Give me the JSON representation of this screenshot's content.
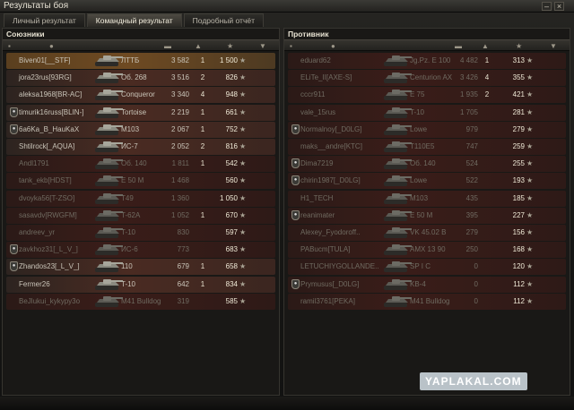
{
  "window": {
    "title": "Результаты боя",
    "minimize": "–",
    "close": "×"
  },
  "tabs": [
    {
      "label": "Личный результат",
      "active": false
    },
    {
      "label": "Командный результат",
      "active": true
    },
    {
      "label": "Подробный отчёт",
      "active": false
    }
  ],
  "allies": {
    "title": "Союзники",
    "rows": [
      {
        "name": "Biven01[__STF]",
        "tank": "ЛТТБ",
        "damage": "3 582",
        "frags": "1",
        "xp": "1 500",
        "state": "player"
      },
      {
        "name": "jora23rus[93RG]",
        "tank": "Об. 268",
        "damage": "3 516",
        "frags": "2",
        "xp": "826",
        "state": "alive"
      },
      {
        "name": "aleksa1968[BR-AC]",
        "tank": "Conqueror",
        "damage": "3 340",
        "frags": "4",
        "xp": "948",
        "state": "alive"
      },
      {
        "name": "timurik16russ[BLIN-]",
        "tank": "Tortoise",
        "damage": "2 219",
        "frags": "1",
        "xp": "661",
        "state": "alive",
        "badge": true
      },
      {
        "name": "6a6Ka_B_HauKaX",
        "tank": "M103",
        "damage": "2 067",
        "frags": "1",
        "xp": "752",
        "state": "alive",
        "badge": true
      },
      {
        "name": "Shtilrock[_AQUA]",
        "tank": "ИС-7",
        "damage": "2 052",
        "frags": "2",
        "xp": "816",
        "state": "alive"
      },
      {
        "name": "Andl1791",
        "tank": "Об. 140",
        "damage": "1 811",
        "frags": "1",
        "xp": "542",
        "state": "dead"
      },
      {
        "name": "tank_ekb[HDST]",
        "tank": "E 50 M",
        "damage": "1 468",
        "frags": "",
        "xp": "560",
        "state": "dead"
      },
      {
        "name": "dvoyka56[T-ZSO]",
        "tank": "T49",
        "damage": "1 360",
        "frags": "",
        "xp": "1 050",
        "state": "dead"
      },
      {
        "name": "sasavdv[RWGFM]",
        "tank": "T-62A",
        "damage": "1 052",
        "frags": "1",
        "xp": "670",
        "state": "dead"
      },
      {
        "name": "andreev_yr",
        "tank": "T-10",
        "damage": "830",
        "frags": "",
        "xp": "597",
        "state": "dead"
      },
      {
        "name": "zavkhoz31[_L_V_]",
        "tank": "ИС-6",
        "damage": "773",
        "frags": "",
        "xp": "683",
        "state": "dead",
        "badge": true
      },
      {
        "name": "Zhandos23[_L_V_]",
        "tank": "110",
        "damage": "679",
        "frags": "1",
        "xp": "658",
        "state": "alive",
        "badge": true
      },
      {
        "name": "Fermer26",
        "tank": "T-10",
        "damage": "642",
        "frags": "1",
        "xp": "834",
        "state": "alive"
      },
      {
        "name": "BeJlukui_kykypy3o",
        "tank": "M41 Bulldog",
        "damage": "319",
        "frags": "",
        "xp": "585",
        "state": "dead"
      }
    ]
  },
  "enemies": {
    "title": "Противник",
    "rows": [
      {
        "name": "eduard62",
        "tank": "Jg.Pz. E 100",
        "damage": "4 482",
        "frags": "1",
        "xp": "313",
        "state": "dead"
      },
      {
        "name": "ELiTe_II[AXE-S]",
        "tank": "Centurion AX",
        "damage": "3 426",
        "frags": "4",
        "xp": "355",
        "state": "dead"
      },
      {
        "name": "cccr911",
        "tank": "E 75",
        "damage": "1 935",
        "frags": "2",
        "xp": "421",
        "state": "dead"
      },
      {
        "name": "vale_15rus",
        "tank": "T-10",
        "damage": "1 705",
        "frags": "",
        "xp": "281",
        "state": "dead"
      },
      {
        "name": "Normalnoy[_D0LG]",
        "tank": "Lowe",
        "damage": "979",
        "frags": "",
        "xp": "279",
        "state": "dead",
        "badge": true
      },
      {
        "name": "maks__andre[KTC]",
        "tank": "T110E5",
        "damage": "747",
        "frags": "",
        "xp": "259",
        "state": "dead"
      },
      {
        "name": "Dima7219",
        "tank": "Об. 140",
        "damage": "524",
        "frags": "",
        "xp": "255",
        "state": "dead",
        "badge": true
      },
      {
        "name": "chirin1987[_D0LG]",
        "tank": "Lowe",
        "damage": "522",
        "frags": "",
        "xp": "193",
        "state": "dead",
        "badge": true
      },
      {
        "name": "H1_TECH",
        "tank": "M103",
        "damage": "435",
        "frags": "",
        "xp": "185",
        "state": "dead"
      },
      {
        "name": "reanimater",
        "tank": "E 50 M",
        "damage": "395",
        "frags": "",
        "xp": "227",
        "state": "dead",
        "badge": true
      },
      {
        "name": "Alexey_Fyodoroff..",
        "tank": "VK 45.02 B",
        "damage": "279",
        "frags": "",
        "xp": "156",
        "state": "dead"
      },
      {
        "name": "PABucm[TULA]",
        "tank": "AMX 13 90",
        "damage": "250",
        "frags": "",
        "xp": "168",
        "state": "dead"
      },
      {
        "name": "LETUCHIYGOLLANDE..",
        "tank": "SP I C",
        "damage": "0",
        "frags": "",
        "xp": "120",
        "state": "dead"
      },
      {
        "name": "Prymusus[_D0LG]",
        "tank": "KB-4",
        "damage": "0",
        "frags": "",
        "xp": "112",
        "state": "dead",
        "badge": true
      },
      {
        "name": "ramil3761[PEKA]",
        "tank": "M41 Bulldog",
        "damage": "0",
        "frags": "",
        "xp": "112",
        "state": "dead"
      }
    ]
  },
  "icons": {
    "star": "★",
    "platoon": "●"
  },
  "watermark": "YAPLAKAL.COM"
}
